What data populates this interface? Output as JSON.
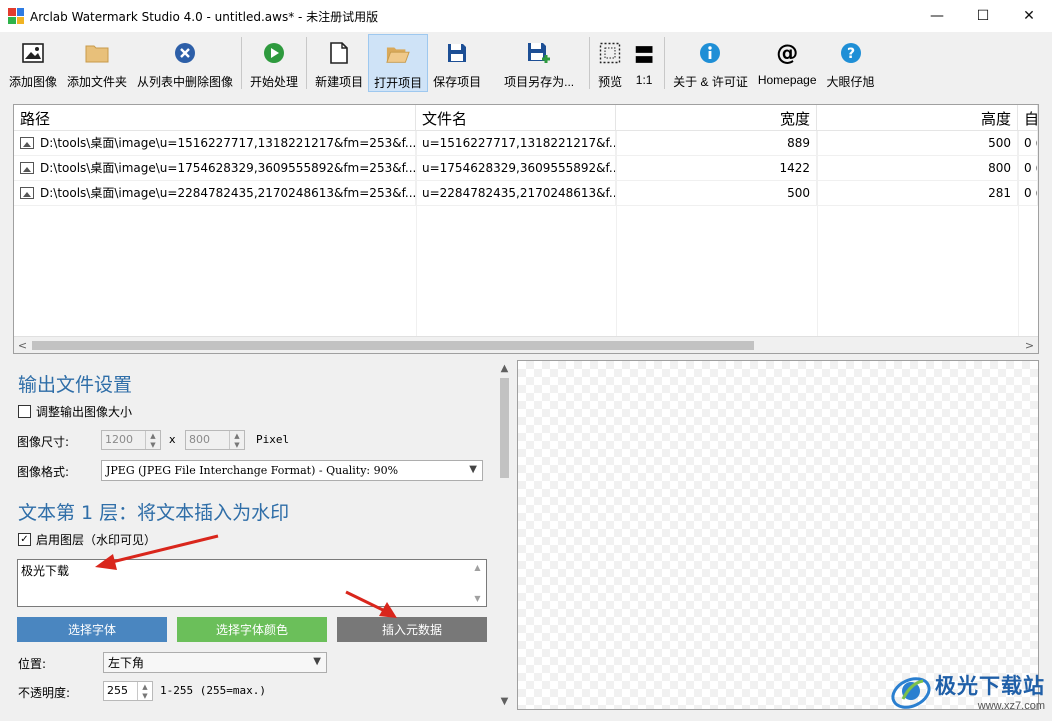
{
  "window": {
    "title": "Arclab Watermark Studio 4.0 - untitled.aws* - 未注册试用版",
    "controls": {
      "minimize": "—",
      "maximize": "☐",
      "close": "✕"
    }
  },
  "toolbar": {
    "add_image": "添加图像",
    "add_folder": "添加文件夹",
    "remove_from_list": "从列表中删除图像",
    "start_processing": "开始处理",
    "new_project": "新建项目",
    "open_project": "打开项目",
    "save_project": "保存项目",
    "save_project_as": "项目另存为...",
    "preview": "预览",
    "one_to_one": "1:1",
    "about_license": "关于 & 许可证",
    "homepage": "Homepage",
    "big_eye": "大眼仔旭",
    "one_to_one_icon": "〓"
  },
  "filelist": {
    "headers": {
      "path": "路径",
      "filename": "文件名",
      "width": "宽度",
      "height": "高度",
      "extra": "自"
    },
    "rows": [
      {
        "path": "D:\\tools\\桌面\\image\\u=1516227717,1318221217&fm=253&f...",
        "filename": "u=1516227717,1318221217&f...",
        "width": "889",
        "height": "500",
        "extra": "0 ("
      },
      {
        "path": "D:\\tools\\桌面\\image\\u=1754628329,3609555892&fm=253&f...",
        "filename": "u=1754628329,3609555892&f...",
        "width": "1422",
        "height": "800",
        "extra": "0 ("
      },
      {
        "path": "D:\\tools\\桌面\\image\\u=2284782435,2170248613&fm=253&f...",
        "filename": "u=2284782435,2170248613&f...",
        "width": "500",
        "height": "281",
        "extra": "0 ("
      }
    ]
  },
  "output": {
    "title": "输出文件设置",
    "resize_label": "调整输出图像大小",
    "size_label": "图像尺寸:",
    "width_value": "1200",
    "x_label": "x",
    "height_value": "800",
    "unit": "Pixel",
    "format_label": "图像格式:",
    "format_value": "JPEG (JPEG File Interchange Format) - Quality: 90%"
  },
  "layer": {
    "title": "文本第 1 层：将文本插入为水印",
    "enable_label": "启用图层（水印可见）",
    "enable_check": "✓",
    "text_value": "极光下载",
    "btn_font": "选择字体",
    "btn_font_color": "选择字体颜色",
    "btn_metadata": "插入元数据",
    "position_label": "位置:",
    "position_value": "左下角",
    "opacity_label": "不透明度:",
    "opacity_value": "255",
    "opacity_hint": "1-255 (255=max.)"
  },
  "watermark": {
    "name": "极光下载站",
    "url": "www.xz7.com"
  },
  "colors": {
    "accent_blue": "#4a86c0",
    "accent_green": "#6bbf5a",
    "accent_gray": "#787878",
    "title_blue": "#2f6ea8",
    "arrow_red": "#d9261c"
  }
}
